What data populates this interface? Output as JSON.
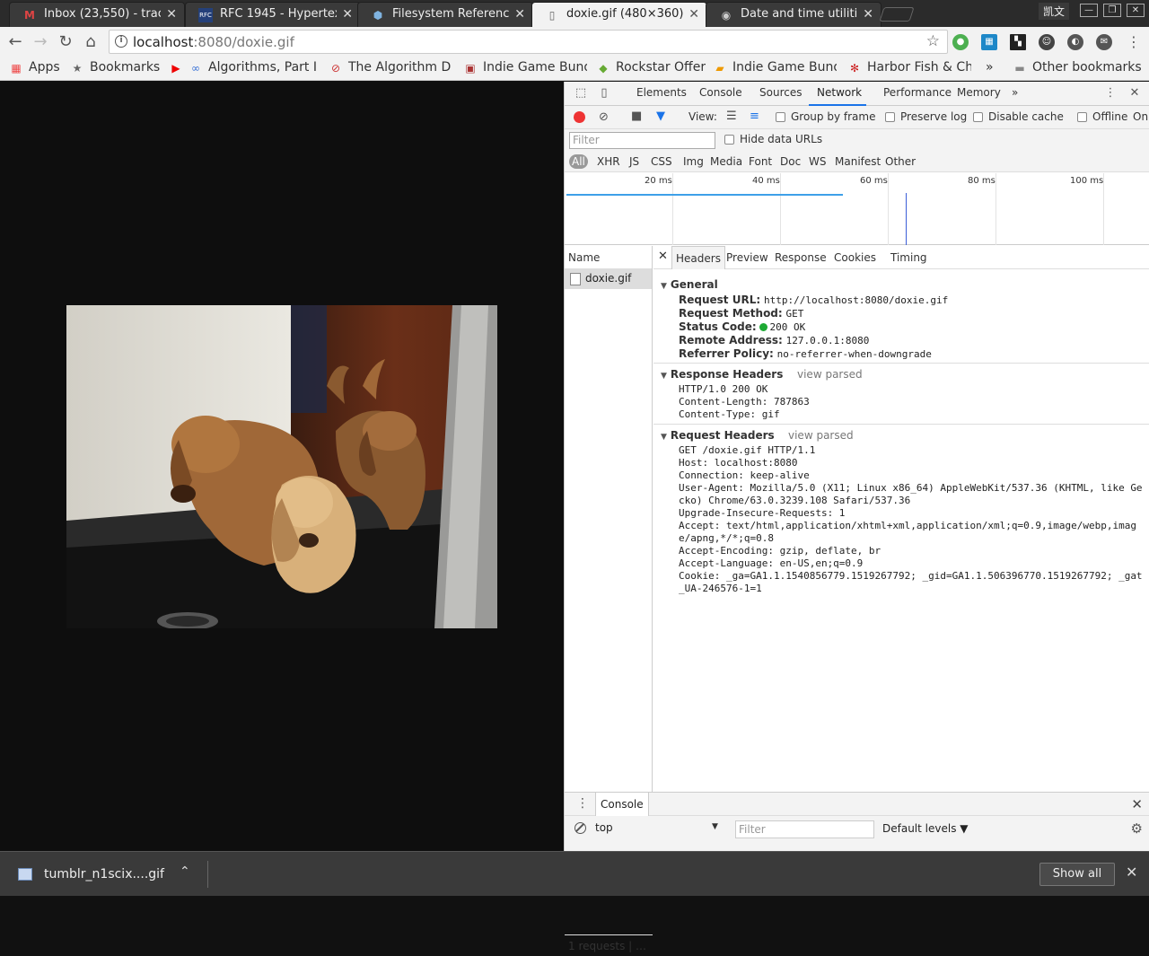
{
  "tabs": [
    {
      "title": "Inbox (23,550) - trac",
      "icon": "gmail-icon"
    },
    {
      "title": "RFC 1945 - Hypertex",
      "icon": "rfc-icon"
    },
    {
      "title": "Filesystem Referenc",
      "icon": "node-icon"
    },
    {
      "title": "doxie.gif (480×360)",
      "icon": "page-icon"
    },
    {
      "title": "Date and time utiliti",
      "icon": "chrome-icon"
    }
  ],
  "profile": "凯文",
  "omnibox": {
    "host": "localhost",
    "path": ":8080/doxie.gif"
  },
  "bookmarks": {
    "apps": "Apps",
    "bookmarks": "Bookmarks",
    "items": [
      "Algorithms, Part I",
      "The Algorithm De",
      "Indie Game Bund",
      "Rockstar Offer",
      "Indie Game Bund",
      "Harbor Fish & Chi"
    ],
    "more": "»",
    "other": "Other bookmarks"
  },
  "devtools": {
    "tabs": [
      "Elements",
      "Console",
      "Sources",
      "Network",
      "Performance",
      "Memory"
    ],
    "more": "»",
    "network_toolbar": {
      "view_label": "View:",
      "group_by_frame": "Group by frame",
      "preserve_log": "Preserve log",
      "disable_cache": "Disable cache",
      "offline": "Offline",
      "online": "On"
    },
    "filter_placeholder": "Filter",
    "hide_data_urls": "Hide data URLs",
    "types": [
      "All",
      "XHR",
      "JS",
      "CSS",
      "Img",
      "Media",
      "Font",
      "Doc",
      "WS",
      "Manifest",
      "Other"
    ],
    "timeline_ticks": [
      "20 ms",
      "40 ms",
      "60 ms",
      "80 ms",
      "100 ms"
    ],
    "name_header": "Name",
    "request_name": "doxie.gif",
    "footer": "1 requests  |  …",
    "detail_tabs": [
      "Headers",
      "Preview",
      "Response",
      "Cookies",
      "Timing"
    ],
    "general": {
      "title": "General",
      "request_url_k": "Request URL:",
      "request_url_v": "http://localhost:8080/doxie.gif",
      "method_k": "Request Method:",
      "method_v": "GET",
      "status_k": "Status Code:",
      "status_v": "200 OK",
      "remote_k": "Remote Address:",
      "remote_v": "127.0.0.1:8080",
      "referrer_k": "Referrer Policy:",
      "referrer_v": "no-referrer-when-downgrade"
    },
    "response_headers": {
      "title": "Response Headers",
      "view_parsed": "view parsed",
      "raw": "HTTP/1.0 200 OK\nContent-Length: 787863\nContent-Type: gif"
    },
    "request_headers": {
      "title": "Request Headers",
      "view_parsed": "view parsed",
      "raw": "GET /doxie.gif HTTP/1.1\nHost: localhost:8080\nConnection: keep-alive\nUser-Agent: Mozilla/5.0 (X11; Linux x86_64) AppleWebKit/537.36 (KHTML, like Gecko) Chrome/63.0.3239.108 Safari/537.36\nUpgrade-Insecure-Requests: 1\nAccept: text/html,application/xhtml+xml,application/xml;q=0.9,image/webp,image/apng,*/*;q=0.8\nAccept-Encoding: gzip, deflate, br\nAccept-Language: en-US,en;q=0.9\nCookie: _ga=GA1.1.1540856779.1519267792; _gid=GA1.1.506396770.1519267792; _gat_UA-246576-1=1"
    },
    "console": {
      "tab": "Console",
      "context": "top",
      "filter_placeholder": "Filter",
      "levels": "Default levels ▼"
    }
  },
  "download": {
    "filename": "tumblr_n1scix....gif",
    "show_all": "Show all"
  }
}
